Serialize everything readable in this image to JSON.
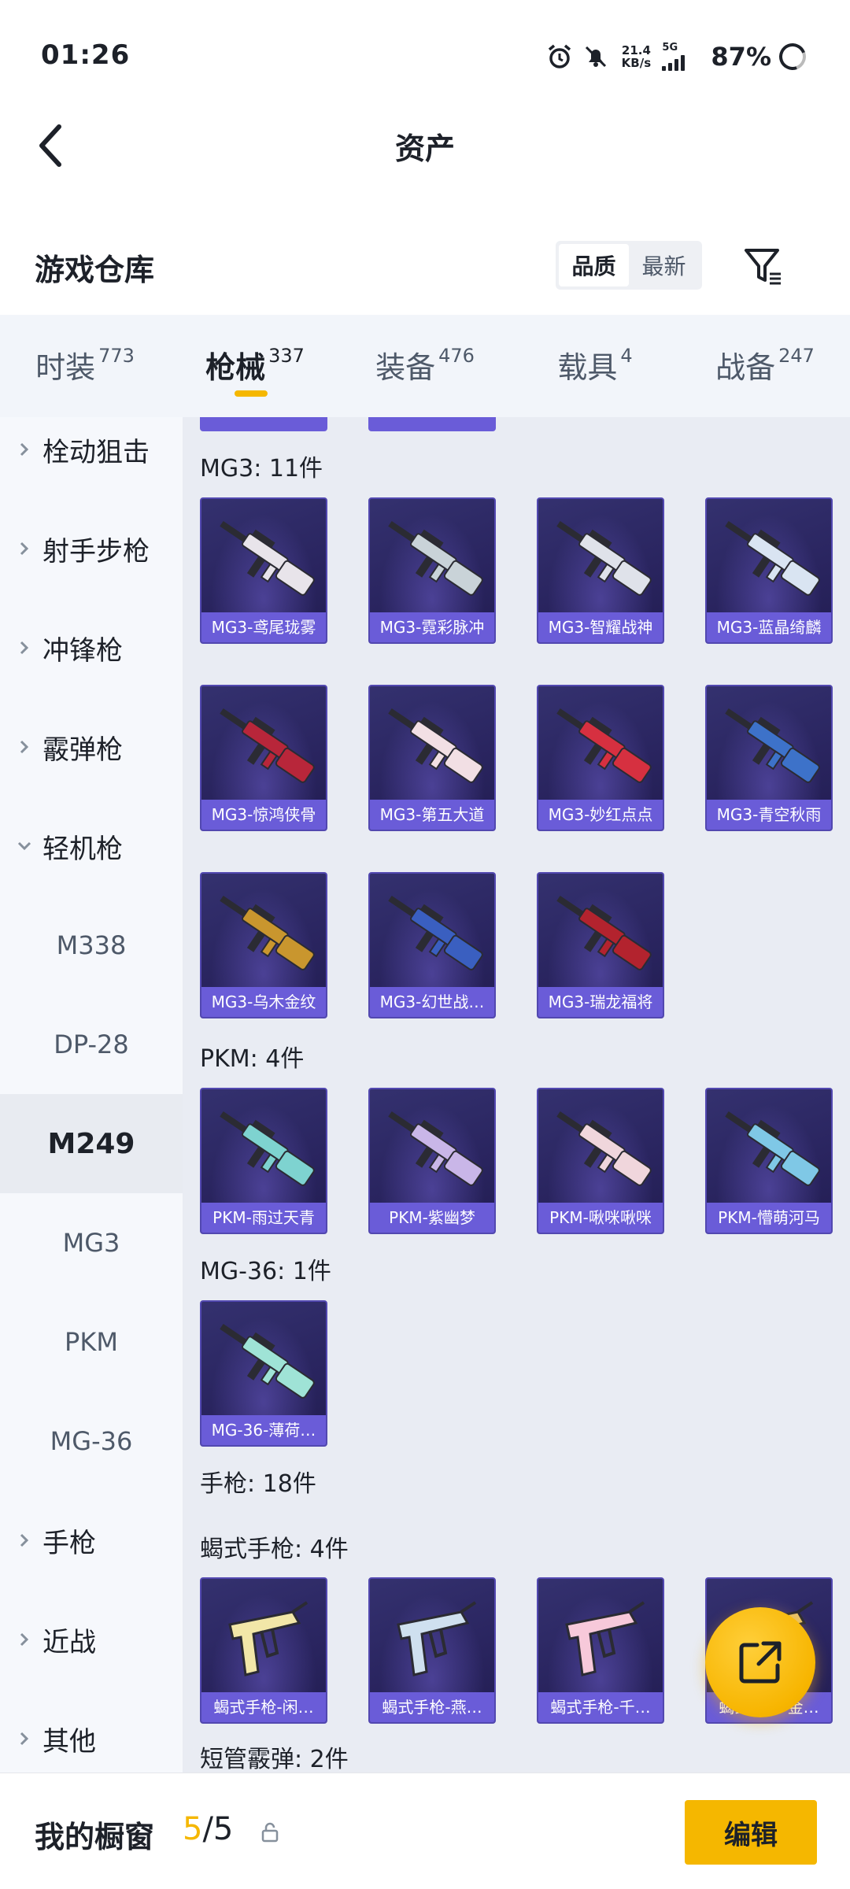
{
  "status_bar": {
    "time": "01:26",
    "speed_value": "21.4",
    "speed_unit": "KB/s",
    "network": "5G",
    "battery": "87%"
  },
  "header": {
    "title": "资产"
  },
  "warehouse": {
    "title": "游戏仓库",
    "sort_options": [
      "品质",
      "最新"
    ],
    "sort_active": "品质"
  },
  "tabs": [
    {
      "label": "时装",
      "count": "773"
    },
    {
      "label": "枪械",
      "count": "337"
    },
    {
      "label": "装备",
      "count": "476"
    },
    {
      "label": "载具",
      "count": "4"
    },
    {
      "label": "战备",
      "count": "247"
    }
  ],
  "active_tab": "枪械",
  "sidebar": [
    {
      "label": "栓动狙击",
      "type": "category"
    },
    {
      "label": "射手步枪",
      "type": "category"
    },
    {
      "label": "冲锋枪",
      "type": "category"
    },
    {
      "label": "霰弹枪",
      "type": "category"
    },
    {
      "label": "轻机枪",
      "type": "category",
      "expanded": true
    },
    {
      "label": "M338",
      "type": "sub"
    },
    {
      "label": "DP-28",
      "type": "sub"
    },
    {
      "label": "M249",
      "type": "sub",
      "selected": true
    },
    {
      "label": "MG3",
      "type": "sub"
    },
    {
      "label": "PKM",
      "type": "sub"
    },
    {
      "label": "MG-36",
      "type": "sub"
    },
    {
      "label": "手枪",
      "type": "category"
    },
    {
      "label": "近战",
      "type": "category"
    },
    {
      "label": "其他",
      "type": "category"
    }
  ],
  "sections": {
    "mg3": {
      "title": "MG3: 11件",
      "items": [
        "MG3-鸢尾珑雾",
        "MG3-霓彩脉冲",
        "MG3-智耀战神",
        "MG3-蓝晶绮麟",
        "MG3-惊鸿侠骨",
        "MG3-第五大道",
        "MG3-妙红点点",
        "MG3-青空秋雨",
        "MG3-乌木金纹",
        "MG3-幻世战…",
        "MG3-瑞龙福将"
      ]
    },
    "pkm": {
      "title": "PKM: 4件",
      "items": [
        "PKM-雨过天青",
        "PKM-紫幽梦",
        "PKM-啾咪啾咪",
        "PKM-懵萌河马"
      ]
    },
    "mg36": {
      "title": "MG-36: 1件",
      "items": [
        "MG-36-薄荷…"
      ]
    },
    "pistol_title": "手枪: 18件",
    "scorpion": {
      "title": "蝎式手枪: 4件",
      "items": [
        "蝎式手枪-闲…",
        "蝎式手枪-燕…",
        "蝎式手枪-千…",
        "蝎式手枪-金…"
      ]
    },
    "sawedoff_title": "短管霰弹: 2件"
  },
  "bottom_bar": {
    "label": "我的橱窗",
    "count_current": "5",
    "count_sep": "/5",
    "edit_label": "编辑"
  },
  "colors": {
    "accent": "#f5b700",
    "card_bg": "#2a2560",
    "card_caption": "#6a5cd8"
  },
  "gun_colors": {
    "mg3": [
      "#e8e4ea",
      "#c9d3d8",
      "#dfe2ea",
      "#d9e4f2",
      "#b8263a",
      "#f2dfe4",
      "#d63040",
      "#3d72c9",
      "#c9962e",
      "#3a5fc0",
      "#b3232e"
    ],
    "pkm": [
      "#7ed3d0",
      "#c9b6e8",
      "#f0d6dc",
      "#7fc8e6"
    ],
    "mg36": [
      "#9fe3d6"
    ],
    "scorpion": [
      "#f2e7a8",
      "#cfe0ef",
      "#f7c9da",
      "#e9c46a"
    ]
  }
}
